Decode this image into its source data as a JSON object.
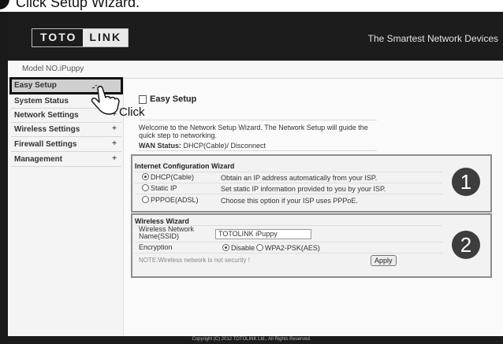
{
  "instruction": {
    "text": "Click Setup Wizard."
  },
  "header": {
    "logo_left": "TOTO",
    "logo_right": "LINK",
    "tagline": "The Smartest Network Devices"
  },
  "model": "Model NO.iPuppy",
  "sidebar": {
    "items": [
      {
        "label": "Easy Setup",
        "plus": "",
        "active": true
      },
      {
        "label": "System Status",
        "plus": "+"
      },
      {
        "label": "Network Settings",
        "plus": "+"
      },
      {
        "label": "Wireless Settings",
        "plus": "+"
      },
      {
        "label": "Firewall Settings",
        "plus": "+"
      },
      {
        "label": "Management",
        "plus": "+"
      }
    ]
  },
  "annotation": {
    "click_label": "Click"
  },
  "page": {
    "title": "Easy Setup",
    "welcome": "Welcome to the Network Setup Wizard. The Network Setup will guide the quick step to networking.",
    "wan_label": "WAN Status:",
    "wan_value": "DHCP(Cable)/ Disconnect"
  },
  "internet_wizard": {
    "title": "Internet Configuration Wizard",
    "badge": "1",
    "options": [
      {
        "label": "DHCP(Cable)",
        "desc": "Obtain an IP address automatically from your ISP.",
        "selected": true
      },
      {
        "label": "Static IP",
        "desc": "Set static IP information provided to you by your ISP.",
        "selected": false
      },
      {
        "label": "PPPOE(ADSL)",
        "desc": "Choose this option if your ISP uses PPPoE.",
        "selected": false
      }
    ]
  },
  "wireless_wizard": {
    "title": "Wireless Wizard",
    "badge": "2",
    "ssid_label": "Wireless Network Name(SSID)",
    "ssid_value": "TOTOLINK iPuppy",
    "encryption_label": "Encryption",
    "enc_disable": "Disable",
    "enc_wpa": "WPA2-PSK(AES)",
    "note": "NOTE:Wireless network is not security !",
    "apply_label": "Apply"
  },
  "footer": {
    "copyright": "Copyright (C) 2012 TOTOLINK Ltd.,   All Rights Reserved."
  },
  "colors": {
    "header_bg": "#1c1c1c",
    "badge_bg": "#3d3d3d",
    "section_border": "#8c8c8c"
  }
}
